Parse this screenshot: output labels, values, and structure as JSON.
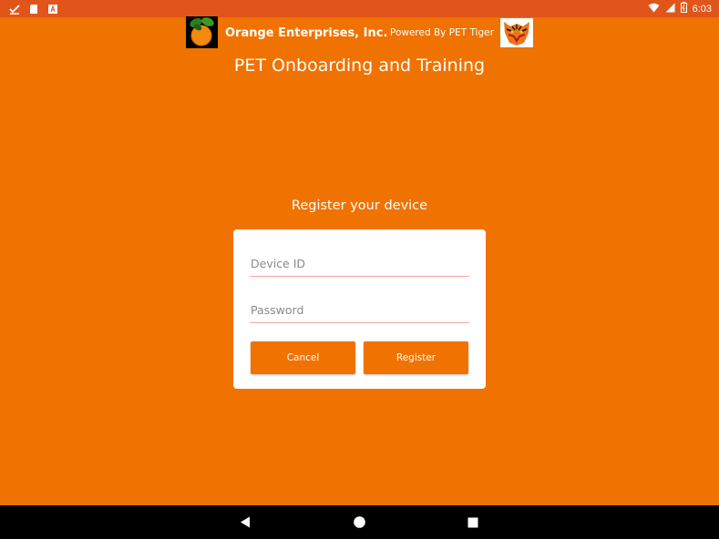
{
  "status_bar": {
    "time": "6:03",
    "icons": [
      "download-check-icon",
      "sd-card-icon",
      "a-notification-icon",
      "wifi-icon",
      "signal-icon",
      "battery-icon"
    ]
  },
  "header": {
    "company_name": "Orange Enterprises, Inc.",
    "powered_by": "Powered By PET Tiger"
  },
  "app_title": "PET Onboarding and Training",
  "register": {
    "heading": "Register your device",
    "device_id_placeholder": "Device ID",
    "device_id_value": "",
    "password_placeholder": "Password",
    "password_value": "",
    "cancel_label": "Cancel",
    "register_label": "Register"
  },
  "nav_bar": {
    "icons": [
      "back-icon",
      "home-icon",
      "recents-icon"
    ]
  },
  "colors": {
    "background": "#f07200",
    "status_bar": "#e2551a",
    "button": "#f07200",
    "card": "#ffffff",
    "field_underline": "#f3a8a0"
  }
}
